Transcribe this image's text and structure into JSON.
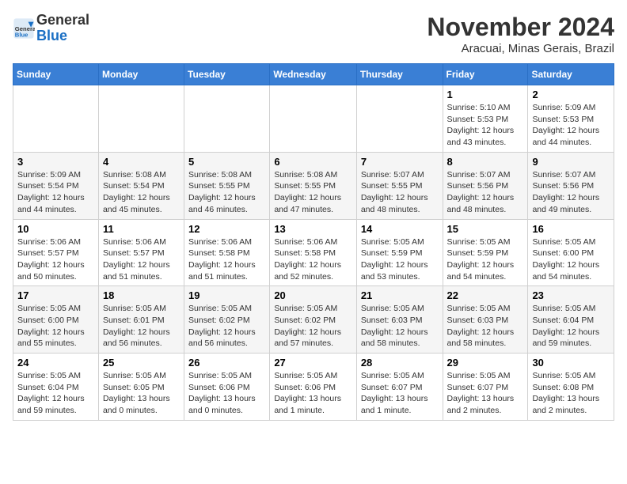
{
  "header": {
    "logo_general": "General",
    "logo_blue": "Blue",
    "month_title": "November 2024",
    "location": "Aracuai, Minas Gerais, Brazil"
  },
  "days_of_week": [
    "Sunday",
    "Monday",
    "Tuesday",
    "Wednesday",
    "Thursday",
    "Friday",
    "Saturday"
  ],
  "weeks": [
    [
      {
        "day": "",
        "info": ""
      },
      {
        "day": "",
        "info": ""
      },
      {
        "day": "",
        "info": ""
      },
      {
        "day": "",
        "info": ""
      },
      {
        "day": "",
        "info": ""
      },
      {
        "day": "1",
        "info": "Sunrise: 5:10 AM\nSunset: 5:53 PM\nDaylight: 12 hours\nand 43 minutes."
      },
      {
        "day": "2",
        "info": "Sunrise: 5:09 AM\nSunset: 5:53 PM\nDaylight: 12 hours\nand 44 minutes."
      }
    ],
    [
      {
        "day": "3",
        "info": "Sunrise: 5:09 AM\nSunset: 5:54 PM\nDaylight: 12 hours\nand 44 minutes."
      },
      {
        "day": "4",
        "info": "Sunrise: 5:08 AM\nSunset: 5:54 PM\nDaylight: 12 hours\nand 45 minutes."
      },
      {
        "day": "5",
        "info": "Sunrise: 5:08 AM\nSunset: 5:55 PM\nDaylight: 12 hours\nand 46 minutes."
      },
      {
        "day": "6",
        "info": "Sunrise: 5:08 AM\nSunset: 5:55 PM\nDaylight: 12 hours\nand 47 minutes."
      },
      {
        "day": "7",
        "info": "Sunrise: 5:07 AM\nSunset: 5:55 PM\nDaylight: 12 hours\nand 48 minutes."
      },
      {
        "day": "8",
        "info": "Sunrise: 5:07 AM\nSunset: 5:56 PM\nDaylight: 12 hours\nand 48 minutes."
      },
      {
        "day": "9",
        "info": "Sunrise: 5:07 AM\nSunset: 5:56 PM\nDaylight: 12 hours\nand 49 minutes."
      }
    ],
    [
      {
        "day": "10",
        "info": "Sunrise: 5:06 AM\nSunset: 5:57 PM\nDaylight: 12 hours\nand 50 minutes."
      },
      {
        "day": "11",
        "info": "Sunrise: 5:06 AM\nSunset: 5:57 PM\nDaylight: 12 hours\nand 51 minutes."
      },
      {
        "day": "12",
        "info": "Sunrise: 5:06 AM\nSunset: 5:58 PM\nDaylight: 12 hours\nand 51 minutes."
      },
      {
        "day": "13",
        "info": "Sunrise: 5:06 AM\nSunset: 5:58 PM\nDaylight: 12 hours\nand 52 minutes."
      },
      {
        "day": "14",
        "info": "Sunrise: 5:05 AM\nSunset: 5:59 PM\nDaylight: 12 hours\nand 53 minutes."
      },
      {
        "day": "15",
        "info": "Sunrise: 5:05 AM\nSunset: 5:59 PM\nDaylight: 12 hours\nand 54 minutes."
      },
      {
        "day": "16",
        "info": "Sunrise: 5:05 AM\nSunset: 6:00 PM\nDaylight: 12 hours\nand 54 minutes."
      }
    ],
    [
      {
        "day": "17",
        "info": "Sunrise: 5:05 AM\nSunset: 6:00 PM\nDaylight: 12 hours\nand 55 minutes."
      },
      {
        "day": "18",
        "info": "Sunrise: 5:05 AM\nSunset: 6:01 PM\nDaylight: 12 hours\nand 56 minutes."
      },
      {
        "day": "19",
        "info": "Sunrise: 5:05 AM\nSunset: 6:02 PM\nDaylight: 12 hours\nand 56 minutes."
      },
      {
        "day": "20",
        "info": "Sunrise: 5:05 AM\nSunset: 6:02 PM\nDaylight: 12 hours\nand 57 minutes."
      },
      {
        "day": "21",
        "info": "Sunrise: 5:05 AM\nSunset: 6:03 PM\nDaylight: 12 hours\nand 58 minutes."
      },
      {
        "day": "22",
        "info": "Sunrise: 5:05 AM\nSunset: 6:03 PM\nDaylight: 12 hours\nand 58 minutes."
      },
      {
        "day": "23",
        "info": "Sunrise: 5:05 AM\nSunset: 6:04 PM\nDaylight: 12 hours\nand 59 minutes."
      }
    ],
    [
      {
        "day": "24",
        "info": "Sunrise: 5:05 AM\nSunset: 6:04 PM\nDaylight: 12 hours\nand 59 minutes."
      },
      {
        "day": "25",
        "info": "Sunrise: 5:05 AM\nSunset: 6:05 PM\nDaylight: 13 hours\nand 0 minutes."
      },
      {
        "day": "26",
        "info": "Sunrise: 5:05 AM\nSunset: 6:06 PM\nDaylight: 13 hours\nand 0 minutes."
      },
      {
        "day": "27",
        "info": "Sunrise: 5:05 AM\nSunset: 6:06 PM\nDaylight: 13 hours\nand 1 minute."
      },
      {
        "day": "28",
        "info": "Sunrise: 5:05 AM\nSunset: 6:07 PM\nDaylight: 13 hours\nand 1 minute."
      },
      {
        "day": "29",
        "info": "Sunrise: 5:05 AM\nSunset: 6:07 PM\nDaylight: 13 hours\nand 2 minutes."
      },
      {
        "day": "30",
        "info": "Sunrise: 5:05 AM\nSunset: 6:08 PM\nDaylight: 13 hours\nand 2 minutes."
      }
    ]
  ]
}
